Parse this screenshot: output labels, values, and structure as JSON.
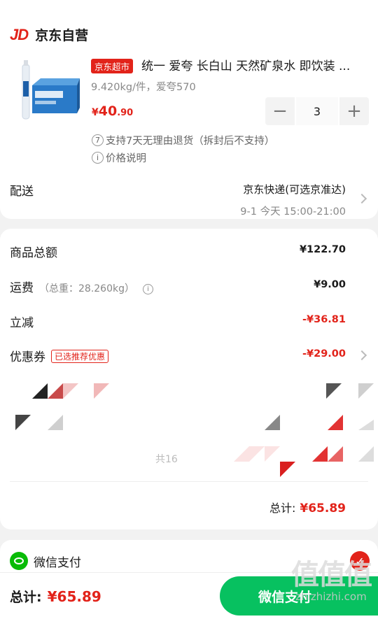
{
  "shop": {
    "logo": "JD",
    "name": "京东自营"
  },
  "product": {
    "tag": "京东超市",
    "title": "统一 爱夸 长白山 天然矿泉水 即饮装 ...",
    "spec": "9.420kg/件，爱夸570",
    "price_yen": "¥",
    "price_int": "40",
    "price_dec": ".90",
    "quantity": "3",
    "minus_label": "−",
    "plus_label": "+",
    "return_icon": "7",
    "return_note": "支持7天无理由退货（拆封后不支持）",
    "price_info_icon": "i",
    "price_info": "价格说明"
  },
  "delivery": {
    "label": "配送",
    "method": "京东快递(可选京准达)",
    "time": "9-1 今天 15:00-21:00"
  },
  "summary": {
    "goods_total_label": "商品总额",
    "goods_total_value": "¥122.70",
    "shipping_label": "运费",
    "shipping_weight": "（总重：28.260kg）",
    "shipping_value": "¥9.00",
    "discount_label": "立减",
    "discount_value": "-¥36.81",
    "coupon_label": "优惠券",
    "coupon_tag": "已选推荐优惠",
    "coupon_value": "-¥29.00",
    "partial_text": "共16",
    "total_label": "总计:",
    "total_value": "¥65.89"
  },
  "payment": {
    "method": "微信支付",
    "check_icon": "✓"
  },
  "bottom": {
    "total_label": "总计:",
    "total_value": "¥65.89",
    "pay_button": "微信支付"
  },
  "watermark": {
    "big": "值值值",
    "small": "zhizhizhi.com"
  },
  "colors": {
    "accent": "#e2231a",
    "wechat": "#07c160",
    "background": "#f2f2f2"
  }
}
